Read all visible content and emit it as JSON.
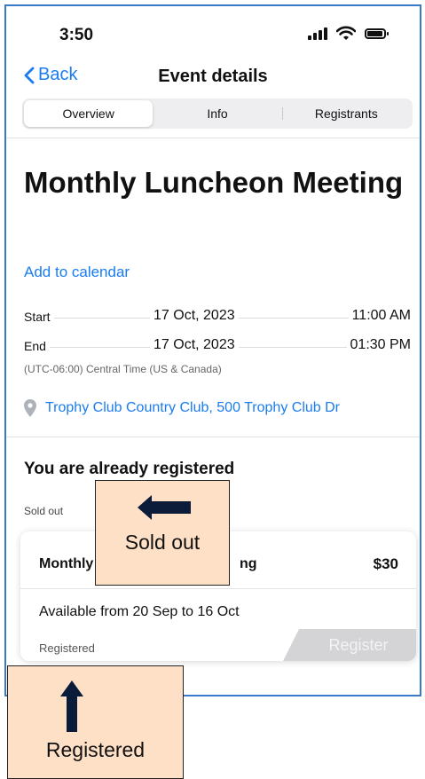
{
  "status_bar": {
    "time": "3:50"
  },
  "nav": {
    "back_label": "Back",
    "title": "Event details"
  },
  "tabs": [
    {
      "label": "Overview",
      "active": true
    },
    {
      "label": "Info",
      "active": false
    },
    {
      "label": "Registrants",
      "active": false
    }
  ],
  "event": {
    "title": "Monthly Luncheon Meeting",
    "add_to_calendar": "Add to calendar",
    "start_label": "Start",
    "start_date": "17 Oct, 2023",
    "start_time": "11:00 AM",
    "end_label": "End",
    "end_date": "17 Oct, 2023",
    "end_time": "01:30 PM",
    "timezone": "(UTC-06:00) Central Time (US & Canada)",
    "location": "Trophy Club Country Club, 500 Trophy Club Dr"
  },
  "registration": {
    "heading": "You are already registered",
    "status": "Sold out"
  },
  "ticket": {
    "name_left": "Monthly",
    "name_right": "ng",
    "price": "$30",
    "availability": "Available from 20 Sep to 16 Oct",
    "status": "Registered",
    "register_label": "Register"
  },
  "callouts": {
    "sold_out": "Sold out",
    "registered": "Registered"
  },
  "colors": {
    "accent": "#1a7cf0",
    "callout_bg": "#fde0c5",
    "frame_border": "#3a78c9",
    "disabled_button": "#d4d4d6"
  }
}
